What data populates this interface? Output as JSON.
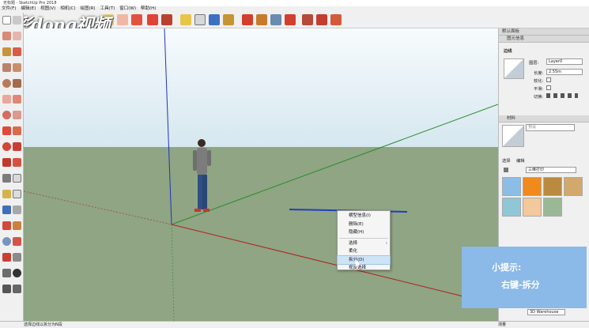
{
  "window": {
    "title": "无标题 - SketchUp Pro 2018"
  },
  "menu": [
    "文件(F)",
    "编辑(E)",
    "视图(V)",
    "相机(C)",
    "绘图(R)",
    "工具(T)",
    "窗口(W)",
    "帮助(H)"
  ],
  "watermark": "彩dong视频",
  "context_menu": {
    "items": [
      "横型信息(I)",
      "删除(E)",
      "隐藏(H)",
      "选择",
      "柔化",
      "拆分(D)",
      "视反选择"
    ],
    "selected_index": 5
  },
  "tray": {
    "title": "默认面板",
    "entity_info": {
      "section": "图元信息",
      "type": "边线",
      "layer_label": "图层:",
      "layer_value": "Layer0",
      "length_label": "长度:",
      "length_value": "2.55m",
      "soft_label": "软化:",
      "smooth_label": "平滑:",
      "shadow_label": "切换:"
    },
    "materials": {
      "section": "材料",
      "default_name": "预设",
      "tab_select": "选择",
      "tab_edit": "编辑",
      "collection": "三维打印",
      "swatch_colors": [
        "#8bbde6",
        "#f08a1c",
        "#b98a3f",
        "#d2a86c",
        "#8fc7d6",
        "#f3c89a",
        "#9bb896"
      ],
      "bottom_field": "3D Warehouse"
    }
  },
  "tip": {
    "line1": "小提示:",
    "line2": "右键-拆分"
  },
  "status": {
    "text": "选择边线以拆分为N段",
    "right": "测量"
  }
}
